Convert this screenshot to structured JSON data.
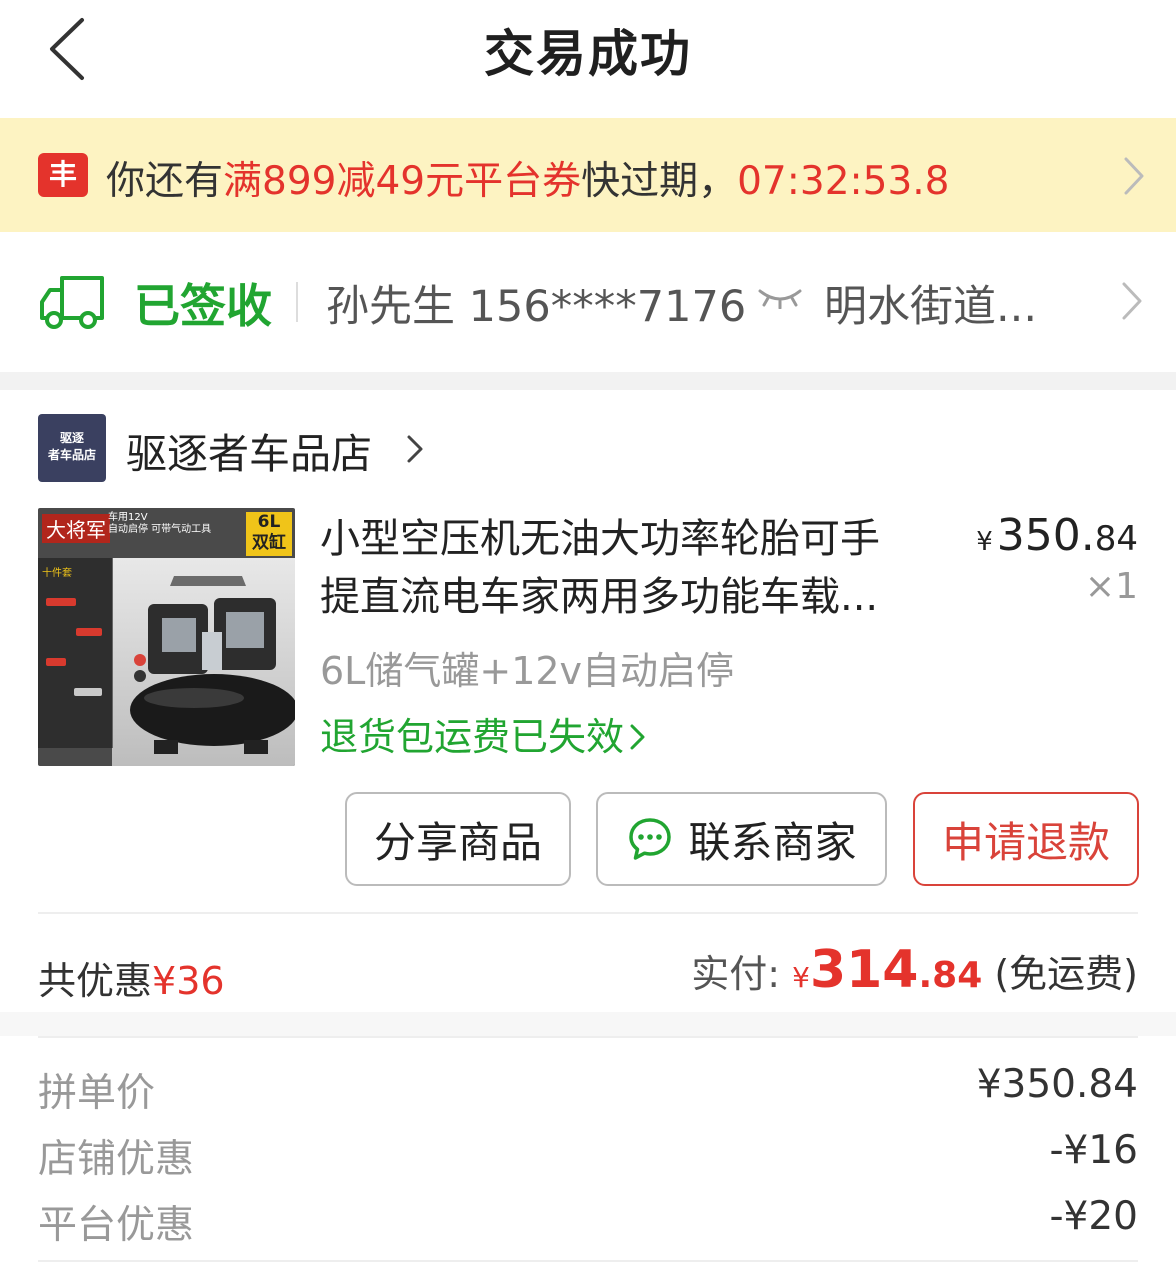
{
  "header": {
    "title": "交易成功"
  },
  "coupon": {
    "icon_text": "丰",
    "prefix": "你还有",
    "coupon_name": "满899减49元平台券",
    "suffix": "快过期，",
    "countdown": "07:32:53.8"
  },
  "delivery": {
    "status": "已签收",
    "recipient": "孙先生 156****7176",
    "address": "明水街道..."
  },
  "store": {
    "logo_text_1": "驱逐",
    "logo_text_2": "者车品店",
    "name": "驱逐者车品店"
  },
  "product": {
    "image_brand": "大将军",
    "image_tag_1": "车用12V",
    "image_tag_2": "自动启停 可带气动工具",
    "image_badge_1": "6L",
    "image_badge_2": "双缸",
    "image_side_title": "十件套",
    "name_line1": "小型空压机无油大功率轮胎可手",
    "name_line2": "提直流电车家两用多功能车载...",
    "price_symbol": "¥",
    "price_int": "350.",
    "price_dec": "84",
    "quantity": "×1",
    "sku": "6L储气罐+12v自动启停",
    "return_note": "退货包运费已失效"
  },
  "actions": {
    "share": "分享商品",
    "contact": "联系商家",
    "refund": "申请退款"
  },
  "summary": {
    "discount_label": "共优惠",
    "discount_value": "¥36",
    "paid_label": "实付: ",
    "paid_symbol": "¥",
    "paid_int": "314",
    "paid_dec": ".84",
    "paid_note": " (免运费)"
  },
  "details": [
    {
      "label": "拼单价",
      "value": "¥350.84"
    },
    {
      "label": "店铺优惠",
      "value": "-¥16"
    },
    {
      "label": "平台优惠",
      "value": "-¥20"
    }
  ],
  "colors": {
    "accent_red": "#e4332c",
    "accent_green": "#21a531",
    "coupon_bg": "#fdf3c2"
  }
}
